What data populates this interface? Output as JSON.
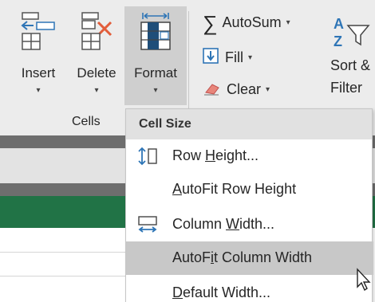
{
  "ribbon": {
    "insert": {
      "label": "Insert",
      "arrow": "▾"
    },
    "delete": {
      "label": "Delete",
      "arrow": "▾"
    },
    "format": {
      "label": "Format",
      "arrow": "▾"
    },
    "group_label": "Cells",
    "autosum": {
      "label": "AutoSum",
      "arrow": "▾"
    },
    "fill": {
      "label": "Fill",
      "arrow": "▾"
    },
    "clear": {
      "label": "Clear",
      "arrow": "▾"
    },
    "sort_filter": {
      "line1": "Sort &",
      "line2": "Filter"
    }
  },
  "menu": {
    "header": "Cell Size",
    "items": [
      {
        "pre": "Row ",
        "key": "H",
        "post": "eight..."
      },
      {
        "pre": "",
        "key": "A",
        "post": "utoFit Row Height"
      },
      {
        "pre": "Column ",
        "key": "W",
        "post": "idth..."
      },
      {
        "pre": "AutoF",
        "key": "i",
        "post": "t Column Width"
      },
      {
        "pre": "",
        "key": "D",
        "post": "efault Width..."
      }
    ]
  },
  "colors": {
    "ribbon_bg": "#ececec",
    "selected_button": "#cfcfcf",
    "menu_header": "#e1e1e1",
    "menu_highlight": "#c8c8c8",
    "sheet_green": "#217346",
    "icon_blue": "#2e75b6",
    "delete_red": "#e25d3a"
  }
}
